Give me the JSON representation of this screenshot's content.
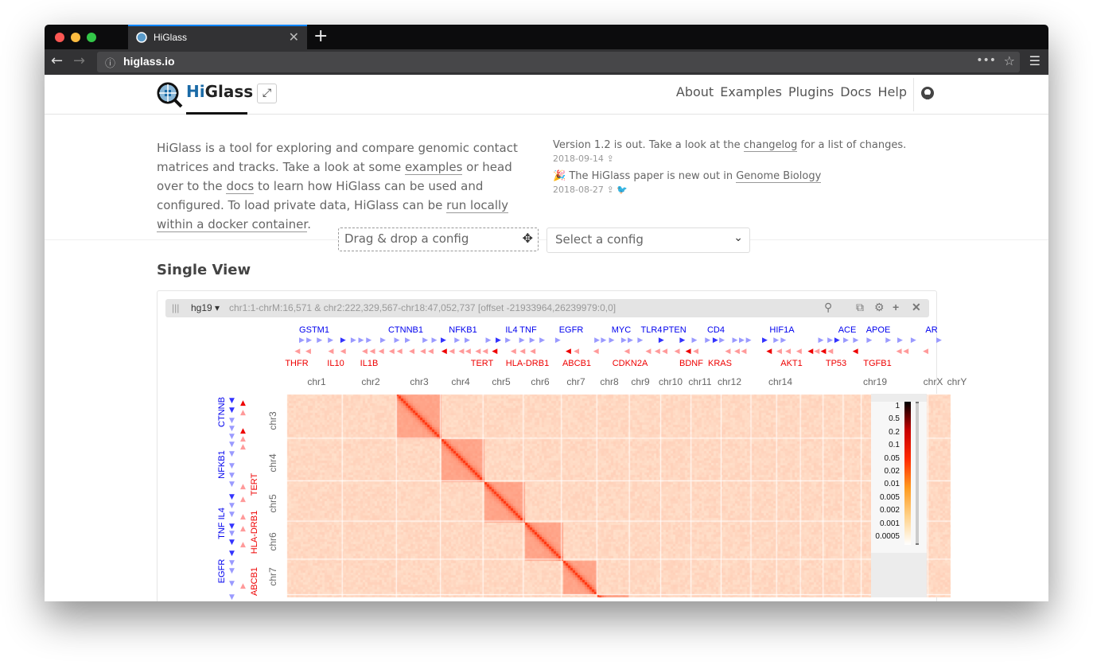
{
  "browser": {
    "tab_title": "HiGlass",
    "url": "higlass.io",
    "close": "✕",
    "new_tab": "+"
  },
  "header": {
    "brand_hi": "Hi",
    "brand_glass": "Glass",
    "fullscreen_icon": "expand-icon",
    "menu": [
      "About",
      "Examples",
      "Plugins",
      "Docs",
      "Help"
    ]
  },
  "intro": {
    "p1": "HiGlass is a tool for exploring and compare genomic contact matrices and tracks. Take a look at some ",
    "l1": "examples",
    "p2": " or head over to the ",
    "l2": "docs",
    "p3": " to learn how HiGlass can be used and configured. To load private data, HiGlass can be ",
    "l3": "run locally within a docker container",
    "p4": "."
  },
  "news": [
    {
      "pre": "Version 1.2 is out. Take a look at the ",
      "link": "changelog",
      "post": " for a list of changes.",
      "date": "2018-09-14"
    },
    {
      "pre": "🎉 The HiGlass paper is new out in ",
      "link": "Genome Biology",
      "post": "",
      "date": "2018-08-27"
    }
  ],
  "config": {
    "drop_placeholder": "Drag & drop a config",
    "select_placeholder": "Select a config"
  },
  "section_title": "Single View",
  "view": {
    "grip": "|||",
    "assembly": "hg19 ▾",
    "location": "chr1:1-chrM:16,571 & chr2:222,329,567-chr18:47,052,737 [offset -21933964,26239979:0,0]"
  },
  "genes_top_plus": [
    "GSTM1",
    "CTNNB1",
    "NFKB1",
    "IL4",
    "TNF",
    "EGFR",
    "MYC",
    "TLR4",
    "PTEN",
    "CD4",
    "HIF1A",
    "ACE",
    "APOE",
    "AR"
  ],
  "genes_top_minus": [
    "THFR",
    "IL10",
    "IL1B",
    "TERT",
    "HLA-DRB1",
    "ABCB1",
    "CDKN2A",
    "BDNF",
    "KRAS",
    "AKT1",
    "TP53",
    "TGFB1"
  ],
  "chroms_top": [
    "chr1",
    "chr2",
    "chr3",
    "chr4",
    "chr5",
    "chr6",
    "chr7",
    "chr8",
    "chr9",
    "chr10",
    "chr11",
    "chr12",
    "chr14",
    "chr19",
    "chrX",
    "chrY"
  ],
  "genes_left_plus": [
    "CTNNB",
    "NFKB1",
    "TNF IL4",
    "EGFR"
  ],
  "genes_left_minus": [
    "TERT",
    "HLA-DRB1",
    "ABCB1"
  ],
  "chroms_left": [
    "chr3",
    "chr4",
    "chr5",
    "chr6",
    "chr7"
  ],
  "colorbar": {
    "ticks": [
      "1",
      "0.5",
      "0.2",
      "0.1",
      "0.05",
      "0.02",
      "0.01",
      "0.005",
      "0.002",
      "0.001",
      "0.0005"
    ],
    "colors": [
      "#ffffff",
      "#ffd28a",
      "#ff9a1e",
      "#ff2a00",
      "#c80000",
      "#000000"
    ]
  },
  "colors": {
    "plus_strand": "#0000ee",
    "minus_strand": "#ee0000",
    "brand": "#1a6aa6"
  }
}
